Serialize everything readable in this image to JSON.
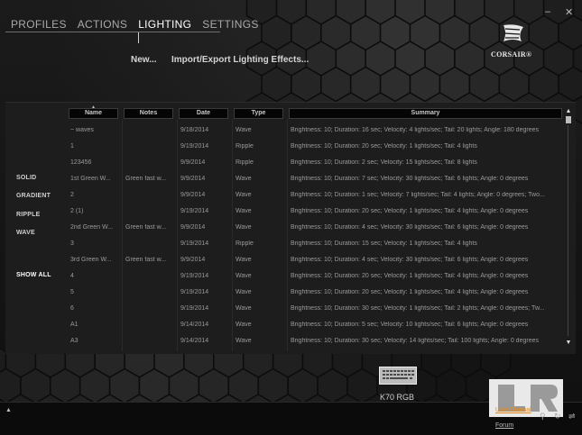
{
  "window": {
    "minimize": "–",
    "close": "✕"
  },
  "nav": {
    "tabs": [
      "PROFILES",
      "ACTIONS",
      "LIGHTING",
      "SETTINGS"
    ],
    "active": "LIGHTING"
  },
  "subnav": {
    "new": "New...",
    "import_export": "Import/Export Lighting Effects..."
  },
  "brand": {
    "logo_text": "CORSAIR®"
  },
  "sidebar": {
    "items": [
      "SOLID",
      "GRADIENT",
      "RIPPLE",
      "WAVE",
      "SHOW ALL"
    ]
  },
  "table": {
    "columns": [
      "Name",
      "Notes",
      "Date",
      "Type",
      "Summary"
    ],
    "rows": [
      [
        "~ waves",
        "",
        "9/18/2014",
        "Wave",
        "Brightness: 10; Duration: 16 sec; Velocity: 4 lights/sec; Tail: 20 lights; Angle: 180 degrees"
      ],
      [
        "1",
        "",
        "9/19/2014",
        "Ripple",
        "Brightness: 10; Duration: 20 sec; Velocity: 1 lights/sec; Tail: 4 lights"
      ],
      [
        "123456",
        "",
        "9/9/2014",
        "Ripple",
        "Brightness: 10; Duration: 2 sec; Velocity: 15 lights/sec; Tail: 8 lights"
      ],
      [
        "1st Green W...",
        "Green fast w...",
        "9/9/2014",
        "Wave",
        "Brightness: 10; Duration: 7 sec; Velocity: 30 lights/sec; Tail: 6 lights; Angle: 0 degrees"
      ],
      [
        "2",
        "",
        "9/9/2014",
        "Wave",
        "Brightness: 10; Duration: 1 sec; Velocity: 7 lights/sec; Tail: 4 lights; Angle: 0 degrees; Two..."
      ],
      [
        "2 (1)",
        "",
        "9/19/2014",
        "Wave",
        "Brightness: 10; Duration: 20 sec; Velocity: 1 lights/sec; Tail: 4 lights; Angle: 0 degrees"
      ],
      [
        "2nd Green W...",
        "Green fast w...",
        "9/9/2014",
        "Wave",
        "Brightness: 10; Duration: 4 sec; Velocity: 30 lights/sec; Tail: 6 lights; Angle: 0 degrees"
      ],
      [
        "3",
        "",
        "9/19/2014",
        "Ripple",
        "Brightness: 10; Duration: 15 sec; Velocity: 1 lights/sec; Tail: 4 lights"
      ],
      [
        "3rd Green W...",
        "Green fast w...",
        "9/9/2014",
        "Wave",
        "Brightness: 10; Duration: 4 sec; Velocity: 30 lights/sec; Tail: 6 lights; Angle: 0 degrees"
      ],
      [
        "4",
        "",
        "9/19/2014",
        "Wave",
        "Brightness: 10; Duration: 20 sec; Velocity: 1 lights/sec; Tail: 4 lights; Angle: 0 degrees"
      ],
      [
        "5",
        "",
        "9/19/2014",
        "Wave",
        "Brightness: 10; Duration: 20 sec; Velocity: 1 lights/sec; Tail: 4 lights; Angle: 0 degrees"
      ],
      [
        "6",
        "",
        "9/19/2014",
        "Wave",
        "Brightness: 10; Duration: 30 sec; Velocity: 1 lights/sec; Tail: 2 lights; Angle: 0 degrees; Tw..."
      ],
      [
        "A1",
        "",
        "9/14/2014",
        "Wave",
        "Brightness: 10; Duration: 5 sec; Velocity: 10 lights/sec; Tail: 6 lights; Angle: 0 degrees"
      ],
      [
        "A3",
        "",
        "9/14/2014",
        "Wave",
        "Brightness: 10; Duration: 30 sec; Velocity: 14 lights/sec; Tail: 100 lights; Angle: 0 degrees"
      ]
    ]
  },
  "scrollbar": {
    "up": "▲",
    "down": "▼"
  },
  "device": {
    "label": "K70 RGB"
  },
  "footer": {
    "up_arrow": "▲",
    "user_manual": "User Manual",
    "forum": "Forum",
    "tray_icons": [
      "⚲",
      "↻",
      "⇌"
    ]
  },
  "colors": {
    "background": "#141414",
    "panel": "#1d1d1d",
    "header": "#050505",
    "text": "#9a9a9a",
    "accent_orange": "#e38a1c"
  }
}
